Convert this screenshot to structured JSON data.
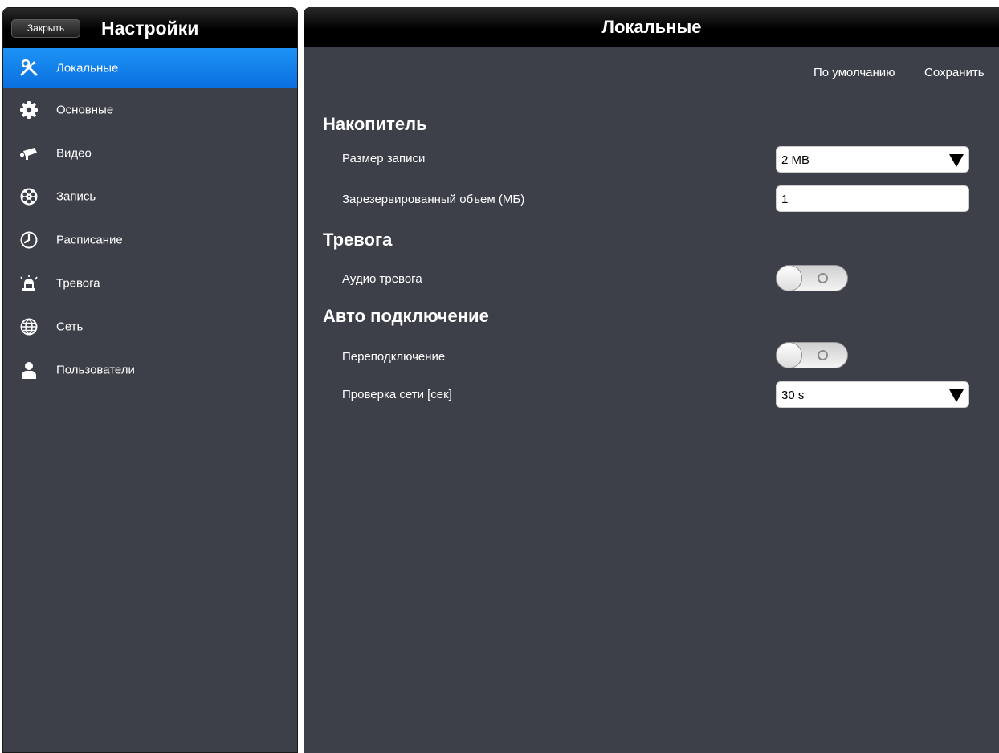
{
  "sidebar": {
    "close_label": "Закрыть",
    "title": "Настройки",
    "items": [
      {
        "label": "Локальные",
        "icon": "tools-icon"
      },
      {
        "label": "Основные",
        "icon": "gear-icon"
      },
      {
        "label": "Видео",
        "icon": "camera-icon"
      },
      {
        "label": "Запись",
        "icon": "film-reel-icon"
      },
      {
        "label": "Расписание",
        "icon": "clock-icon"
      },
      {
        "label": "Тревога",
        "icon": "alarm-siren-icon"
      },
      {
        "label": "Сеть",
        "icon": "globe-icon"
      },
      {
        "label": "Пользователи",
        "icon": "user-icon"
      }
    ],
    "active_index": 0
  },
  "main": {
    "title": "Локальные",
    "toolbar": {
      "default_label": "По умолчанию",
      "save_label": "Сохранить"
    },
    "sections": {
      "storage": {
        "title": "Накопитель",
        "record_size_label": "Размер записи",
        "record_size_value": "2 MB",
        "reserved_label": "Зарезервированный объем (МБ)",
        "reserved_value": "1"
      },
      "alarm": {
        "title": "Тревога",
        "audio_alarm_label": "Аудио тревога",
        "audio_alarm_on": false
      },
      "auto_connect": {
        "title": "Авто подключение",
        "reconnect_label": "Переподключение",
        "reconnect_on": false,
        "network_check_label": "Проверка сети [сек]",
        "network_check_value": "30 s"
      }
    }
  },
  "colors": {
    "panel_bg": "#3e4049",
    "active_item": "#1a8cf2",
    "header_bg": "#000000"
  }
}
